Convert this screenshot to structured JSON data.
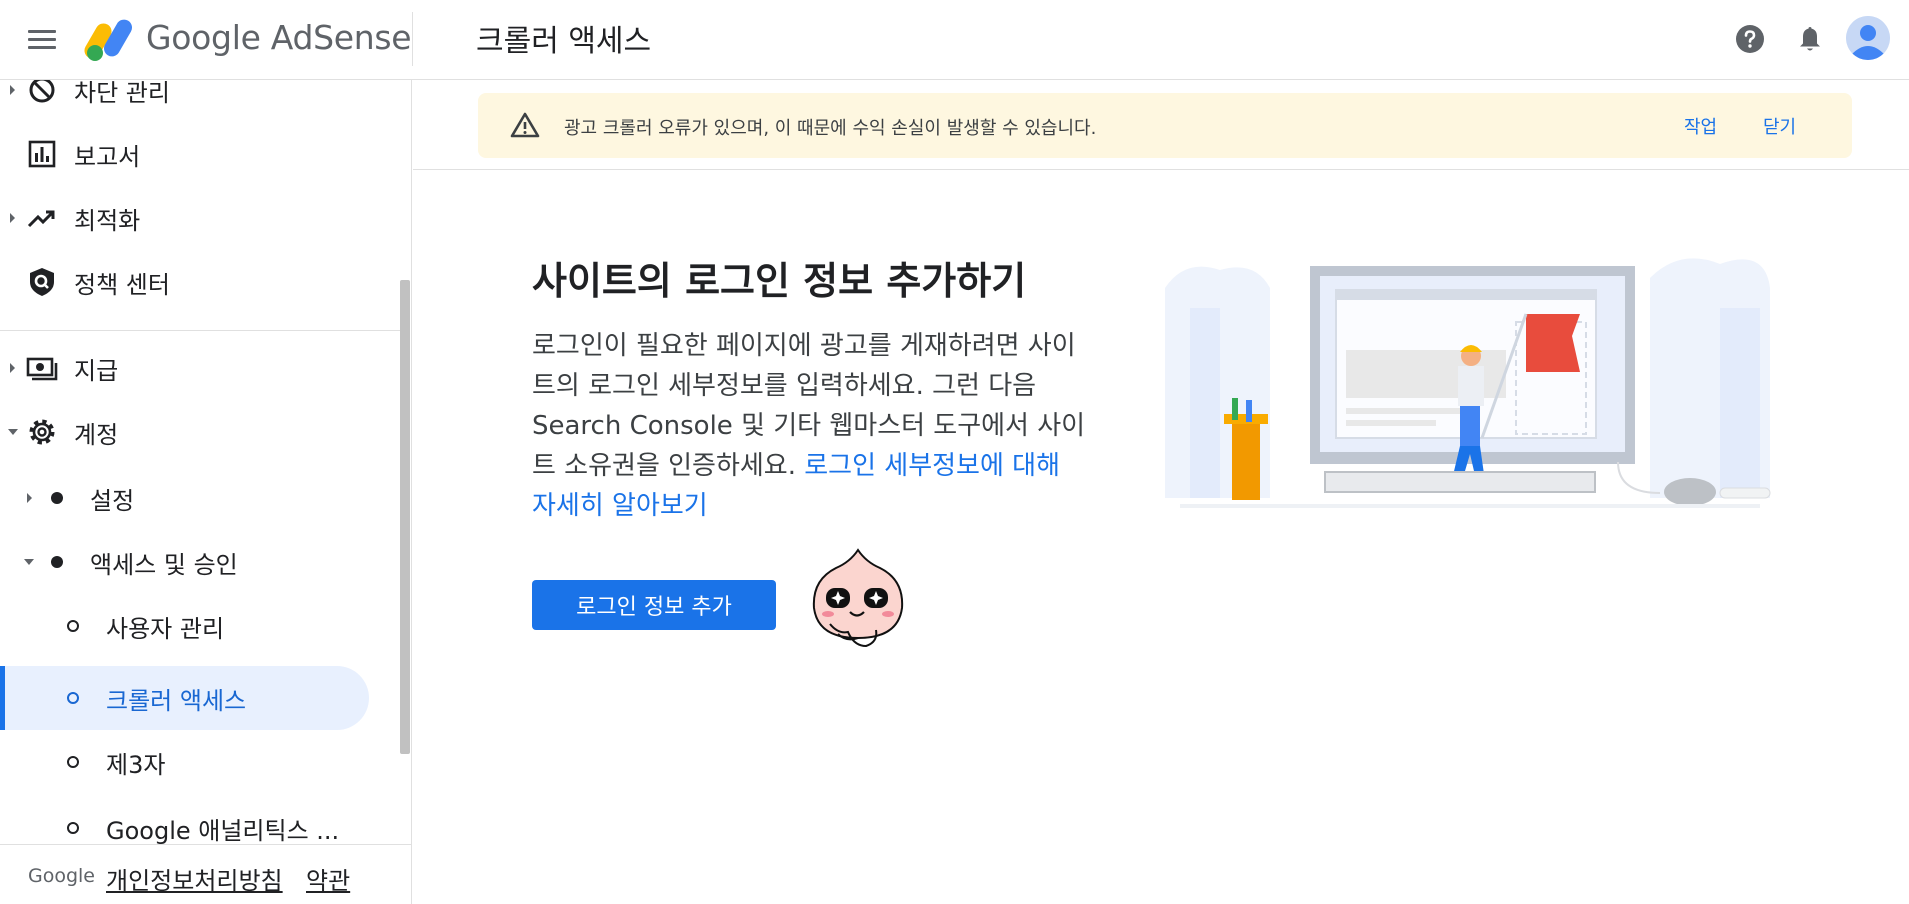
{
  "header": {
    "menu_icon": "hamburger-menu-icon",
    "logo_google": "Google",
    "logo_product": "AdSense",
    "title": "크롤러 액세스",
    "help_icon": "help-icon",
    "notifications_icon": "bell-icon",
    "avatar_icon": "account-avatar-icon"
  },
  "sidebar": {
    "items": [
      {
        "label": "차단 관리",
        "icon": "block-icon",
        "expandable": true
      },
      {
        "label": "보고서",
        "icon": "bar-chart-icon"
      },
      {
        "label": "최적화",
        "icon": "trending-up-icon",
        "expandable": true
      },
      {
        "label": "정책 센터",
        "icon": "policy-shield-icon"
      },
      {
        "label": "지급",
        "icon": "payments-icon",
        "expandable": true
      },
      {
        "label": "계정",
        "icon": "gear-icon",
        "expanded": true
      },
      {
        "label": "설정",
        "expandable": true
      },
      {
        "label": "액세스 및 승인",
        "expanded": true
      },
      {
        "label": "사용자 관리"
      },
      {
        "label": "크롤러 액세스",
        "active": true
      },
      {
        "label": "제3자"
      },
      {
        "label": "Google 애널리틱스 ..."
      }
    ],
    "footer": {
      "google": "Google",
      "privacy": "개인정보처리방침",
      "terms": "약관"
    }
  },
  "banner": {
    "message": "광고 크롤러 오류가 있으며, 이 때문에 수익 손실이 발생할 수 있습니다.",
    "action": "작업",
    "dismiss": "닫기"
  },
  "main": {
    "heading": "사이트의 로그인 정보 추가하기",
    "description": "로그인이 필요한 페이지에 광고를 게재하려면 사이트의 로그인 세부정보를 입력하세요. 그런 다음 Search Console 및 기타 웹마스터 도구에서 사이트 소유권을 인증하세요. ",
    "learn_more": "로그인 세부정보에 대해 자세히 알아보기",
    "button": "로그인 정보 추가"
  },
  "colors": {
    "accent": "#1a73e8",
    "banner_bg": "#fef7e0",
    "active_bg": "#e8f0fe"
  }
}
